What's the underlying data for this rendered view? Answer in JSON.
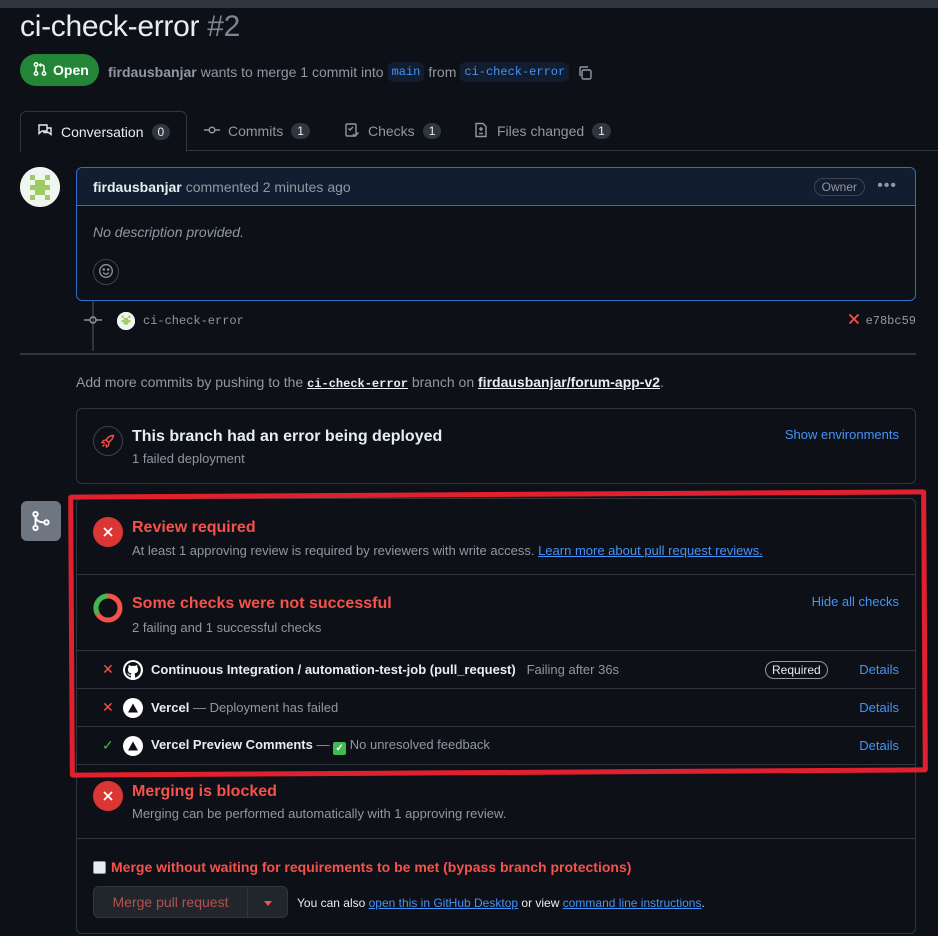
{
  "pr": {
    "title": "ci-check-error",
    "number": "#2",
    "state": "Open",
    "author": "firdausbanjar",
    "merge_text": "wants to merge 1 commit into",
    "base_branch": "main",
    "from_text": "from",
    "head_branch": "ci-check-error"
  },
  "tabs": [
    {
      "label": "Conversation",
      "count": "0"
    },
    {
      "label": "Commits",
      "count": "1"
    },
    {
      "label": "Checks",
      "count": "1"
    },
    {
      "label": "Files changed",
      "count": "1"
    }
  ],
  "comment": {
    "author": "firdausbanjar",
    "action": "commented 2 minutes ago",
    "role": "Owner",
    "body": "No description provided."
  },
  "commit": {
    "message": "ci-check-error",
    "sha": "e78bc59"
  },
  "hint": {
    "prefix": "Add more commits by pushing to the",
    "branch": "ci-check-error",
    "middle": "branch on",
    "repo": "firdausbanjar/forum-app-v2",
    "suffix": "."
  },
  "deployment": {
    "title": "This branch had an error being deployed",
    "subtitle": "1 failed deployment",
    "link": "Show environments"
  },
  "review": {
    "title": "Review required",
    "subtitle": "At least 1 approving review is required by reviewers with write access.",
    "link": "Learn more about pull request reviews."
  },
  "checks": {
    "title": "Some checks were not successful",
    "subtitle": "2 failing and 1 successful checks",
    "link": "Hide all checks",
    "items": [
      {
        "status": "✕",
        "name": "Continuous Integration / automation-test-job (pull_request)",
        "desc": "Failing after 36s",
        "badge": "Required",
        "details": "Details"
      },
      {
        "status": "✕",
        "name": "Vercel",
        "desc": "— Deployment has failed",
        "details": "Details"
      },
      {
        "status": "✓",
        "name": "Vercel Preview Comments",
        "sep": "—",
        "desc": "No unresolved feedback",
        "details": "Details"
      }
    ]
  },
  "blocked": {
    "title": "Merging is blocked",
    "subtitle": "Merging can be performed automatically with 1 approving review."
  },
  "merge": {
    "bypass_label": "Merge without waiting for requirements to be met (bypass branch protections)",
    "button": "Merge pull request",
    "note_prefix": "You can also",
    "desktop_link": "open this in GitHub Desktop",
    "note_middle": "or view",
    "cli_link": "command line instructions",
    "note_suffix": "."
  },
  "colors": {
    "danger": "#f85149",
    "success": "#3fb950",
    "accent": "#4493f8",
    "open_green": "#238636",
    "annotation_red": "#e0202e"
  }
}
